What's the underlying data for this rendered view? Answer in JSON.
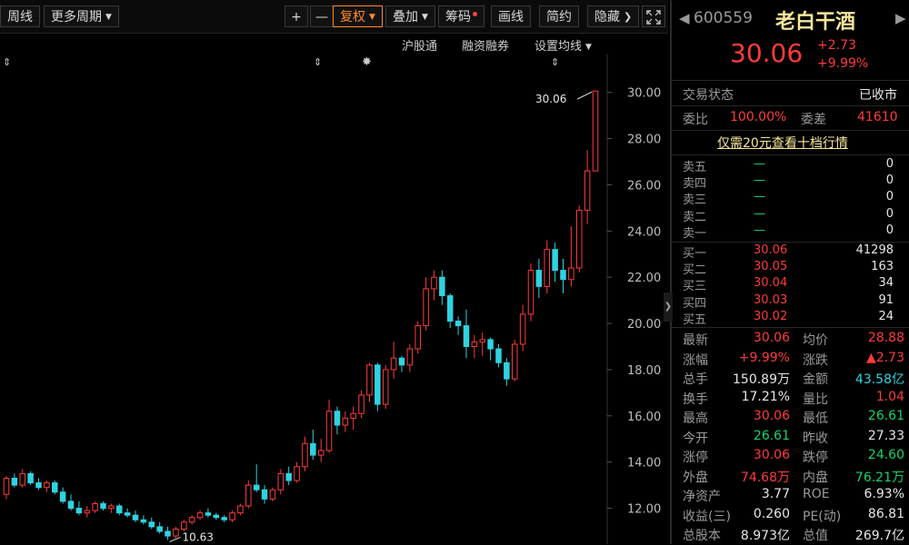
{
  "toolbar": {
    "weekly": "周线",
    "more_periods": "更多周期",
    "plus": "+",
    "minus": "—",
    "restore_rights": "复权",
    "overlay": "叠加",
    "chips": "筹码",
    "draw_line": "画线",
    "simple": "简约",
    "hide": "隐藏",
    "expand_icon": "expand-icon"
  },
  "subbar": {
    "hsgt": "沪股通",
    "margin": "融资融券",
    "set_ma": "设置均线"
  },
  "chart_data": {
    "type": "candlestick",
    "y_ticks": [
      "30.00",
      "28.00",
      "26.00",
      "24.00",
      "22.00",
      "20.00",
      "18.00",
      "16.00",
      "14.00",
      "12.00"
    ],
    "ylim": [
      11,
      30.5
    ],
    "high_label": "30.06",
    "low_label": "10.63",
    "candles": [
      [
        12.6,
        13.4,
        12.4,
        13.3
      ],
      [
        13.3,
        13.5,
        12.9,
        13.0
      ],
      [
        13.0,
        13.7,
        12.9,
        13.5
      ],
      [
        13.5,
        13.6,
        13.0,
        13.1
      ],
      [
        13.1,
        13.3,
        12.8,
        12.9
      ],
      [
        12.9,
        13.2,
        12.7,
        13.1
      ],
      [
        13.1,
        13.2,
        12.6,
        12.7
      ],
      [
        12.7,
        12.9,
        12.2,
        12.3
      ],
      [
        12.3,
        12.6,
        11.9,
        12.0
      ],
      [
        12.0,
        12.3,
        11.7,
        11.8
      ],
      [
        11.8,
        12.1,
        11.6,
        11.9
      ],
      [
        11.9,
        12.3,
        11.8,
        12.2
      ],
      [
        12.2,
        12.3,
        11.9,
        12.0
      ],
      [
        12.0,
        12.2,
        11.8,
        12.1
      ],
      [
        12.1,
        12.2,
        11.7,
        11.8
      ],
      [
        11.8,
        12.0,
        11.6,
        11.7
      ],
      [
        11.7,
        11.9,
        11.4,
        11.5
      ],
      [
        11.5,
        11.7,
        11.3,
        11.4
      ],
      [
        11.4,
        11.6,
        11.1,
        11.2
      ],
      [
        11.2,
        11.4,
        10.9,
        11.0
      ],
      [
        11.0,
        11.2,
        10.63,
        10.8
      ],
      [
        10.8,
        11.2,
        10.7,
        11.1
      ],
      [
        11.1,
        11.5,
        11.0,
        11.4
      ],
      [
        11.4,
        11.7,
        11.3,
        11.6
      ],
      [
        11.6,
        11.9,
        11.5,
        11.8
      ],
      [
        11.8,
        12.0,
        11.6,
        11.7
      ],
      [
        11.7,
        11.8,
        11.5,
        11.6
      ],
      [
        11.6,
        11.7,
        11.4,
        11.5
      ],
      [
        11.5,
        11.9,
        11.4,
        11.8
      ],
      [
        11.8,
        12.2,
        11.7,
        12.1
      ],
      [
        12.1,
        13.2,
        12.0,
        13.0
      ],
      [
        13.0,
        13.9,
        12.7,
        12.8
      ],
      [
        12.8,
        13.0,
        12.2,
        12.4
      ],
      [
        12.4,
        12.9,
        12.3,
        12.8
      ],
      [
        12.8,
        13.7,
        12.6,
        13.5
      ],
      [
        13.5,
        13.8,
        13.0,
        13.2
      ],
      [
        13.2,
        14.0,
        13.1,
        13.8
      ],
      [
        13.8,
        15.1,
        13.6,
        14.8
      ],
      [
        14.8,
        15.4,
        14.1,
        14.3
      ],
      [
        14.3,
        15.0,
        14.0,
        14.5
      ],
      [
        14.5,
        16.7,
        14.4,
        16.2
      ],
      [
        16.2,
        16.4,
        15.2,
        15.6
      ],
      [
        15.6,
        16.2,
        15.3,
        15.9
      ],
      [
        15.9,
        16.4,
        15.4,
        16.1
      ],
      [
        16.1,
        17.1,
        15.9,
        16.9
      ],
      [
        16.9,
        18.3,
        16.6,
        18.2
      ],
      [
        18.2,
        18.3,
        16.2,
        16.5
      ],
      [
        16.5,
        18.2,
        16.3,
        18.0
      ],
      [
        18.0,
        19.2,
        17.6,
        18.5
      ],
      [
        18.5,
        18.6,
        17.9,
        18.2
      ],
      [
        18.2,
        19.1,
        17.9,
        18.9
      ],
      [
        18.9,
        20.1,
        18.7,
        19.9
      ],
      [
        19.9,
        22.0,
        19.7,
        21.5
      ],
      [
        21.5,
        22.3,
        21.0,
        22.0
      ],
      [
        22.0,
        22.3,
        20.8,
        21.2
      ],
      [
        21.2,
        21.3,
        19.8,
        20.1
      ],
      [
        20.1,
        20.3,
        19.5,
        19.9
      ],
      [
        19.9,
        20.6,
        18.5,
        19.0
      ],
      [
        19.0,
        19.5,
        18.5,
        19.2
      ],
      [
        19.2,
        19.6,
        18.6,
        19.3
      ],
      [
        19.3,
        19.4,
        18.4,
        18.9
      ],
      [
        18.9,
        19.1,
        18.1,
        18.3
      ],
      [
        18.3,
        18.5,
        17.3,
        17.6
      ],
      [
        17.6,
        19.3,
        17.5,
        19.1
      ],
      [
        19.1,
        20.8,
        18.8,
        20.4
      ],
      [
        20.4,
        22.6,
        20.1,
        22.3
      ],
      [
        22.3,
        22.8,
        21.1,
        21.6
      ],
      [
        21.6,
        23.6,
        21.3,
        23.2
      ],
      [
        23.2,
        23.5,
        21.8,
        22.3
      ],
      [
        22.3,
        22.8,
        21.3,
        21.9
      ],
      [
        21.9,
        24.2,
        21.6,
        22.4
      ],
      [
        22.4,
        25.1,
        22.2,
        24.9
      ],
      [
        24.9,
        27.5,
        24.3,
        26.6
      ],
      [
        26.6,
        30.06,
        26.61,
        30.06
      ]
    ]
  },
  "panel": {
    "code": "600559",
    "name": "老白干酒",
    "price": "30.06",
    "change": "+2.73",
    "change_pct": "+9.99%",
    "status_label": "交易状态",
    "status_value": "已收市",
    "wb_label": "委比",
    "wb_value": "100.00%",
    "wc_label": "委差",
    "wc_value": "41610",
    "promo": "仅需20元查看十档行情",
    "asks": [
      {
        "label": "卖五",
        "price": "—",
        "vol": "0"
      },
      {
        "label": "卖四",
        "price": "—",
        "vol": "0"
      },
      {
        "label": "卖三",
        "price": "—",
        "vol": "0"
      },
      {
        "label": "卖二",
        "price": "—",
        "vol": "0"
      },
      {
        "label": "卖一",
        "price": "—",
        "vol": "0"
      }
    ],
    "bids": [
      {
        "label": "买一",
        "price": "30.06",
        "vol": "41298"
      },
      {
        "label": "买二",
        "price": "30.05",
        "vol": "163"
      },
      {
        "label": "买三",
        "price": "30.04",
        "vol": "34"
      },
      {
        "label": "买四",
        "price": "30.03",
        "vol": "91"
      },
      {
        "label": "买五",
        "price": "30.02",
        "vol": "24"
      }
    ],
    "quotes": [
      {
        "l1": "最新",
        "v1": "30.06",
        "c1": "red",
        "l2": "均价",
        "v2": "28.88",
        "c2": "red"
      },
      {
        "l1": "涨幅",
        "v1": "+9.99%",
        "c1": "red",
        "l2": "涨跌",
        "v2": "▲2.73",
        "c2": "red"
      },
      {
        "l1": "总手",
        "v1": "150.89万",
        "c1": "white",
        "l2": "金额",
        "v2": "43.58亿",
        "c2": "cyan"
      },
      {
        "l1": "换手",
        "v1": "17.21%",
        "c1": "white",
        "l2": "量比",
        "v2": "1.04",
        "c2": "red"
      },
      {
        "l1": "最高",
        "v1": "30.06",
        "c1": "red",
        "l2": "最低",
        "v2": "26.61",
        "c2": "green"
      },
      {
        "l1": "今开",
        "v1": "26.61",
        "c1": "green",
        "l2": "昨收",
        "v2": "27.33",
        "c2": "white"
      },
      {
        "l1": "涨停",
        "v1": "30.06",
        "c1": "red",
        "l2": "跌停",
        "v2": "24.60",
        "c2": "green"
      },
      {
        "l1": "外盘",
        "v1": "74.68万",
        "c1": "red",
        "l2": "内盘",
        "v2": "76.21万",
        "c2": "green"
      },
      {
        "l1": "净资产",
        "v1": "3.77",
        "c1": "white",
        "l2": "ROE",
        "v2": "6.93%",
        "c2": "white"
      },
      {
        "l1": "收益(三)",
        "v1": "0.260",
        "c1": "white",
        "l2": "PE(动)",
        "v2": "86.81",
        "c2": "white"
      },
      {
        "l1": "总股本",
        "v1": "8.973亿",
        "c1": "white",
        "l2": "总值",
        "v2": "269.7亿",
        "c2": "white"
      }
    ],
    "colors": {
      "up": "#ff3b3b",
      "down": "#19d36b",
      "cyan": "#2fd3e0",
      "accent": "#ff8a2a"
    }
  }
}
